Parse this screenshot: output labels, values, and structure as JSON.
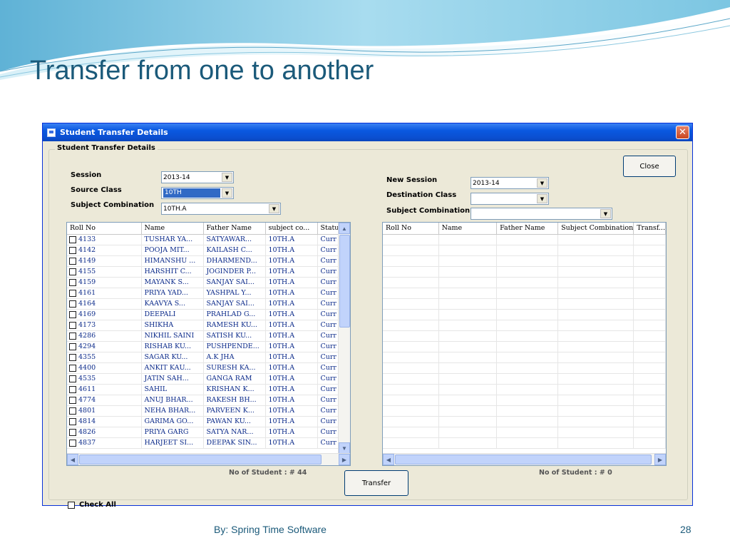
{
  "slide": {
    "title": "Transfer from one to another",
    "footer": "By: Spring Time Software",
    "page_number": "28"
  },
  "window": {
    "title": "Student Transfer Details",
    "close_glyph": "✕",
    "group_legend": "Student Transfer Details"
  },
  "source": {
    "session_label": "Session",
    "session_value": "2013-14",
    "class_label": "Source Class",
    "class_value": "10TH",
    "subject_label": "Subject Combination",
    "subject_value": "10TH.A",
    "columns": [
      "Roll No",
      "Name",
      "Father Name",
      "subject co...",
      "Statu"
    ],
    "rows": [
      {
        "roll": "4133",
        "name": "TUSHAR YA...",
        "father": "SATYAWAR...",
        "subject": "10TH.A",
        "status": "Curr"
      },
      {
        "roll": "4142",
        "name": "POOJA MIT...",
        "father": "KAILASH C...",
        "subject": "10TH.A",
        "status": "Curr"
      },
      {
        "roll": "4149",
        "name": "HIMANSHU ...",
        "father": "DHARMEND...",
        "subject": "10TH.A",
        "status": "Curr"
      },
      {
        "roll": "4155",
        "name": "HARSHIT C...",
        "father": "JOGINDER P...",
        "subject": "10TH.A",
        "status": "Curr"
      },
      {
        "roll": "4159",
        "name": "MAYANK S...",
        "father": "SANJAY SAI...",
        "subject": "10TH.A",
        "status": "Curr"
      },
      {
        "roll": "4161",
        "name": "PRIYA YAD...",
        "father": "YASHPAL Y...",
        "subject": "10TH.A",
        "status": "Curr"
      },
      {
        "roll": "4164",
        "name": "KAAVYA S...",
        "father": "SANJAY SAI...",
        "subject": "10TH.A",
        "status": "Curr"
      },
      {
        "roll": "4169",
        "name": "DEEPALI",
        "father": "PRAHLAD G...",
        "subject": "10TH.A",
        "status": "Curr"
      },
      {
        "roll": "4173",
        "name": "SHIKHA",
        "father": "RAMESH KU...",
        "subject": "10TH.A",
        "status": "Curr"
      },
      {
        "roll": "4286",
        "name": "NIKHIL SAINI",
        "father": "SATISH KU...",
        "subject": "10TH.A",
        "status": "Curr"
      },
      {
        "roll": "4294",
        "name": "RISHAB KU...",
        "father": "PUSHPENDE...",
        "subject": "10TH.A",
        "status": "Curr"
      },
      {
        "roll": "4355",
        "name": "SAGAR KU...",
        "father": "A.K JHA",
        "subject": "10TH.A",
        "status": "Curr"
      },
      {
        "roll": "4400",
        "name": "ANKIT KAU...",
        "father": "SURESH KA...",
        "subject": "10TH.A",
        "status": "Curr"
      },
      {
        "roll": "4535",
        "name": "JATIN SAH...",
        "father": "GANGA RAM",
        "subject": "10TH.A",
        "status": "Curr"
      },
      {
        "roll": "4611",
        "name": "SAHIL",
        "father": "KRISHAN K...",
        "subject": "10TH.A",
        "status": "Curr"
      },
      {
        "roll": "4774",
        "name": "ANUJ BHAR...",
        "father": "RAKESH BH...",
        "subject": "10TH.A",
        "status": "Curr"
      },
      {
        "roll": "4801",
        "name": "NEHA BHAR...",
        "father": "PARVEEN K...",
        "subject": "10TH.A",
        "status": "Curr"
      },
      {
        "roll": "4814",
        "name": "GARIMA GO...",
        "father": "PAWAN KU...",
        "subject": "10TH.A",
        "status": "Curr"
      },
      {
        "roll": "4826",
        "name": "PRIYA GARG",
        "father": "SATYA NAR...",
        "subject": "10TH.A",
        "status": "Curr"
      },
      {
        "roll": "4837",
        "name": "HARJEET SI...",
        "father": "DEEPAK SIN...",
        "subject": "10TH.A",
        "status": "Curr"
      }
    ],
    "count_label": "No of Student : # 44",
    "check_all_label": "Check All"
  },
  "destination": {
    "session_label": "New Session",
    "session_value": "2013-14",
    "class_label": "Destination Class",
    "class_value": "",
    "subject_label": "Subject Combination",
    "subject_value": "",
    "columns": [
      "Roll No",
      "Name",
      "Father Name",
      "Subject Combination",
      "Transf..."
    ],
    "count_label": "No of Student : # 0"
  },
  "buttons": {
    "close_label": "Close",
    "transfer_label": "Transfer"
  },
  "icons": {
    "dropdown": "▼",
    "scroll_up": "▲",
    "scroll_down": "▼",
    "scroll_left": "◀",
    "scroll_right": "▶"
  },
  "colors": {
    "slide_title": "#1b5a7a",
    "titlebar": "#0a58e0",
    "window_bg": "#ece9d8",
    "selection": "#316ac5"
  }
}
